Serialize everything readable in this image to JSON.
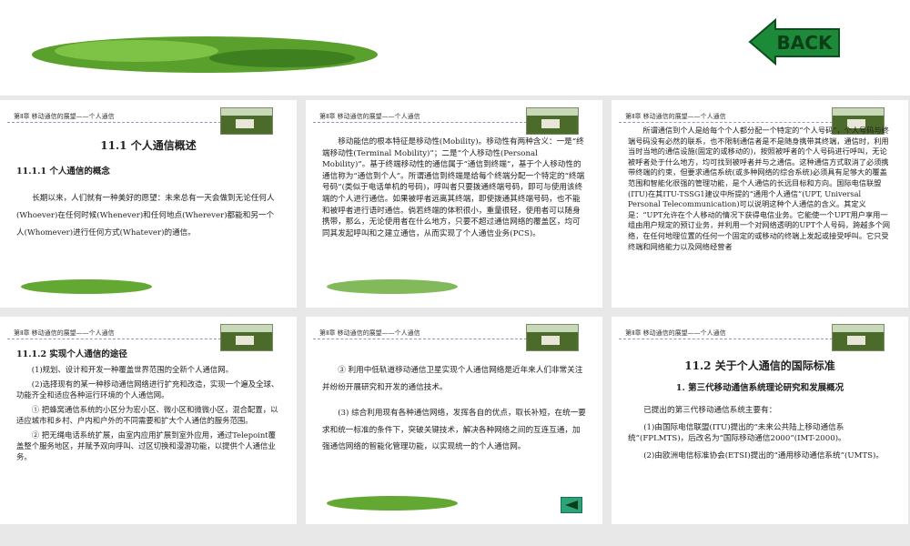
{
  "back_button": {
    "label": "BACK"
  },
  "slides": [
    {
      "header": "第Ⅱ章 移动通信的展望——个人通信",
      "title": "11.1  个人通信概述",
      "subtitle": "11.1.1  个人通信的概念",
      "paras": [
        "长期以来，人们就有一种美好的愿望：未来总有一天会做到无论任何人(Whoever)在任何时候(Whenever)和任何地点(Wherever)都能和另一个人(Whomever)进行任何方式(Whatever)的通信。"
      ]
    },
    {
      "header": "第Ⅱ章 移动通信的展望——个人通信",
      "paras": [
        "移动能信的根本特征是移动性(Mobility)。移动性有两种含义：一是“终端移动性(Terminal Mobility)”；二是“个人移动性(Personal Mobility)”。基于终端移动性的通信属于“通信到终端”，基于个人移动性的通信称为“通信到个人”。所谓通信到终端是给每个终端分配一个特定的“终端号码”(类似于电话单机的号码)，呼叫者只要拨通终端号码，即可与使用该终端的个人进行通信。如果被呼者远离其终端，即使拨通其终端号码，也不能和被呼者进行语时通信。倘若终端的体积很小，重量很轻，使用者可以随身携带，那么，无论使用者在什么地方，只要不超过通信网络的覆盖区，均可同其发起呼叫和之建立通信，从而实现了个人通信业务(PCS)。"
      ]
    },
    {
      "header": "第Ⅱ章 移动通信的展望——个人通信",
      "paras": [
        "所谓通信到个人是给每个个人都分配一个特定的“个人号码”，个人号码与终端号码没有必然的联系，也不限制通信者是不是随身携带其终端，通信时，利用当时当地的通信设施(固定的或移动的)，按照被呼者的个人号码进行呼叫，无论被呼者处于什么地方，均可找到被呼者并与之通信。这种通信方式取消了必须携带终端的约束，但要求通信系统(或多种网络的综合系统)必须具有足够大的覆盖范围和智能化很强的管理功能，是个人通信的长远目标和方向。国际电信联盟(ITU)在其ITU-TSSG1建议中所提的“通用个人通信”(UPT, Universal Personal Telecommunication)可以说明这种个人通信的含义。其定义是：“UPT允许在个人移动的情况下获得电信业务。它能使一个UPT用户享用一组由用户规定的预订业务，并利用一个对网络透明的UPT个人号码，跨越多个网络，在任何地理位置的任何一个固定的或移动的终端上发起或接受呼叫。它只受终端和网络能力以及网络经营者"
      ]
    },
    {
      "header": "第Ⅱ章 移动通信的展望——个人通信",
      "subtitle": "11.1.2  实现个人通信的途径",
      "paras": [
        "(1)规划、设计和开发一种覆盖世界范围的全新个人通信网。",
        "(2)选择现有的某一种移动通信网络进行扩充和改造，实现一个遍及全球、功能齐全和适应各种运行环境的个人通信网。",
        "① 把蜂窝通信系统的小区分为宏小区、微小区和微微小区，混合配置，以适应城市和乡村、户内和户外的不同需要和扩大个人通信的服务范围。",
        "② 把无绳电话系统扩展，由室内应用扩展到室外应用，通过Telepoint覆盖整个服务地区，并赋予双向呼叫、过区切换和漫游功能，以提供个人通信业务。"
      ]
    },
    {
      "header": "第Ⅱ章 移动通信的展望——个人通信",
      "paras": [
        "③ 利用中低轨道移动通信卫星实现个人通信网络是近年来人们非常关注并纷纷开展研究和开发的通信技术。",
        "(3)  综合利用现有各种通信网络，发挥各自的优点，取长补短，在统一要求和统一标准的条件下，突破关键技术，解决各种网络之间的互连互通，加强通信网络的智能化管理功能，以实现统一的个人通信网。"
      ]
    },
    {
      "header": "第Ⅱ章 移动通信的展望——个人通信",
      "title": "11.2  关于个人通信的国际标准",
      "subtitle": "1.    第三代移动通信系统理论研究和发展概况",
      "paras": [
        "已提出的第三代移动通信系统主要有：",
        "(1)由国际电信联盟(ITU)提出的“未来公共陆上移动通信系统”(FPLMTS)，后改名为“国际移动通信2000”(IMT-2000)。",
        "(2)由欧洲电信标准协会(ETSI)提出的“通用移动通信系统”(UMTS)。"
      ]
    }
  ]
}
